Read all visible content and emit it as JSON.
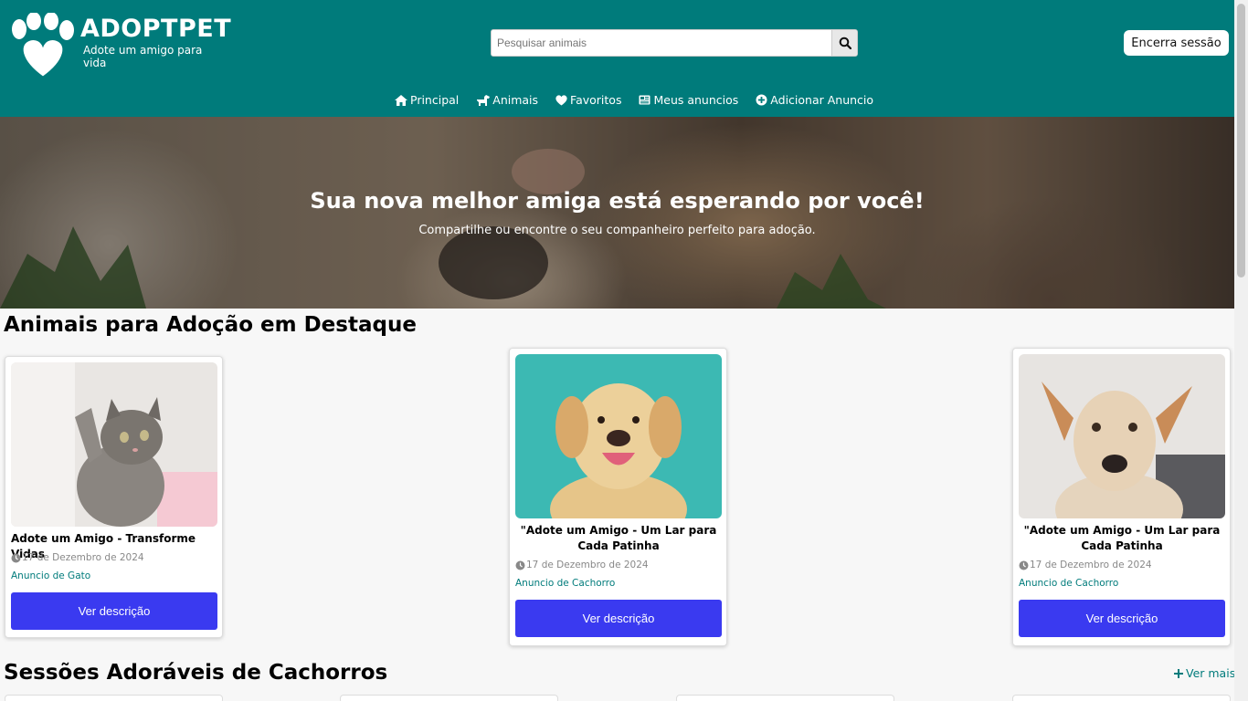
{
  "header": {
    "logo_title": "ADOPTPET",
    "logo_subtitle": "Adote um amigo para  vida",
    "search_placeholder": "Pesquisar animais",
    "logout_label": "Encerra sessão",
    "brand_color": "#007b7b"
  },
  "nav": {
    "items": [
      {
        "label": "Principal",
        "icon": "home-icon"
      },
      {
        "label": "Animais",
        "icon": "dog-icon"
      },
      {
        "label": "Favoritos",
        "icon": "heart-icon"
      },
      {
        "label": "Meus anuncios",
        "icon": "newspaper-icon"
      },
      {
        "label": "Adicionar Anuncio",
        "icon": "plus-circle-icon"
      }
    ]
  },
  "hero": {
    "title": "Sua nova melhor amiga está esperando por você!",
    "subtitle": "Compartilhe ou encontre o seu companheiro perfeito para adoção."
  },
  "featured": {
    "title": "Animais para Adoção em Destaque",
    "cards": [
      {
        "title": "Adote um Amigo - Transforme Vidas",
        "date": "17 de Dezembro de 2024",
        "category": "Anuncio de Gato",
        "button": "Ver descrição",
        "image": "kitten-photo"
      },
      {
        "title": "\"Adote um Amigo - Um Lar para Cada Patinha",
        "date": "17 de Dezembro de 2024",
        "category": "Anuncio de Cachorro",
        "button": "Ver descrição",
        "image": "labrador-photo"
      },
      {
        "title": "\"Adote um Amigo - Um Lar para Cada Patinha",
        "date": "17 de Dezembro de 2024",
        "category": "Anuncio de Cachorro",
        "button": "Ver descrição",
        "image": "mixed-dog-photo"
      }
    ]
  },
  "dogs_section": {
    "title": "Sessões Adoráveis de Cachorros",
    "see_more": "Ver mais"
  },
  "colors": {
    "button": "#3a3af0",
    "accent": "#007b7b"
  }
}
